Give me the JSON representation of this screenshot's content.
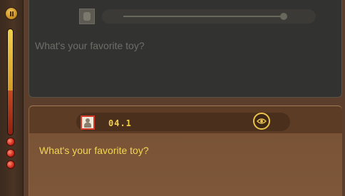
{
  "sidebar": {
    "pause_icon": "pause-icon",
    "lives": 3
  },
  "top_panel": {
    "question": "What's your favorite toy?"
  },
  "bottom_panel": {
    "timestamp": "04.1",
    "question": "What's your favorite toy?",
    "eye_icon": "eye-icon"
  },
  "colors": {
    "accent": "#f2d653",
    "inactive_text": "#6e6d68",
    "avatar_border": "#d43a2a"
  }
}
